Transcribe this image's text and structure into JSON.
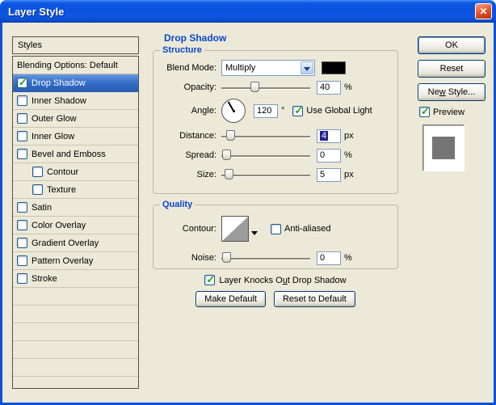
{
  "window": {
    "title": "Layer Style"
  },
  "colors": {
    "selection": "#316ac5",
    "accent_blue": "#0b46d0",
    "titlebar_blue": "#0a52dd",
    "dialog_bg": "#ece9d8",
    "swatch": "#000000"
  },
  "styles_panel": {
    "header": "Styles",
    "items": [
      {
        "label": "Blending Options: Default",
        "checked": null
      },
      {
        "label": "Drop Shadow",
        "checked": true,
        "selected": true
      },
      {
        "label": "Inner Shadow",
        "checked": false
      },
      {
        "label": "Outer Glow",
        "checked": false
      },
      {
        "label": "Inner Glow",
        "checked": false
      },
      {
        "label": "Bevel and Emboss",
        "checked": false
      },
      {
        "label": "Contour",
        "checked": false,
        "indent": true
      },
      {
        "label": "Texture",
        "checked": false,
        "indent": true
      },
      {
        "label": "Satin",
        "checked": false
      },
      {
        "label": "Color Overlay",
        "checked": false
      },
      {
        "label": "Gradient Overlay",
        "checked": false
      },
      {
        "label": "Pattern Overlay",
        "checked": false
      },
      {
        "label": "Stroke",
        "checked": false
      }
    ]
  },
  "main": {
    "section_title": "Drop Shadow",
    "structure": {
      "title": "Structure",
      "blend_mode": {
        "label": "Blend Mode:",
        "value": "Multiply",
        "swatch_color": "#000000"
      },
      "opacity": {
        "label": "Opacity:",
        "value": "40",
        "unit": "%"
      },
      "angle": {
        "label": "Angle:",
        "value": "120",
        "unit": "°"
      },
      "use_global_light": {
        "label": "Use Global Light",
        "checked": true
      },
      "distance": {
        "label": "Distance:",
        "value": "4",
        "unit": "px",
        "text_selected": true
      },
      "spread": {
        "label": "Spread:",
        "value": "0",
        "unit": "%"
      },
      "size": {
        "label": "Size:",
        "value": "5",
        "unit": "px"
      }
    },
    "quality": {
      "title": "Quality",
      "contour": {
        "label": "Contour:"
      },
      "anti_aliased": {
        "label": "Anti-aliased",
        "checked": false
      },
      "noise": {
        "label": "Noise:",
        "value": "0",
        "unit": "%"
      }
    },
    "knockout": {
      "prefix": "Layer Knocks O",
      "mnemonic": "u",
      "suffix": "t Drop Shadow",
      "checked": true
    },
    "footer_buttons": {
      "make_default": "Make Default",
      "reset_to_default": "Reset to Default"
    }
  },
  "side": {
    "ok": "OK",
    "reset": "Reset",
    "new_style": {
      "prefix": "Ne",
      "mnemonic": "w",
      "suffix": " Style..."
    },
    "preview": {
      "label": "Preview",
      "checked": true
    }
  }
}
